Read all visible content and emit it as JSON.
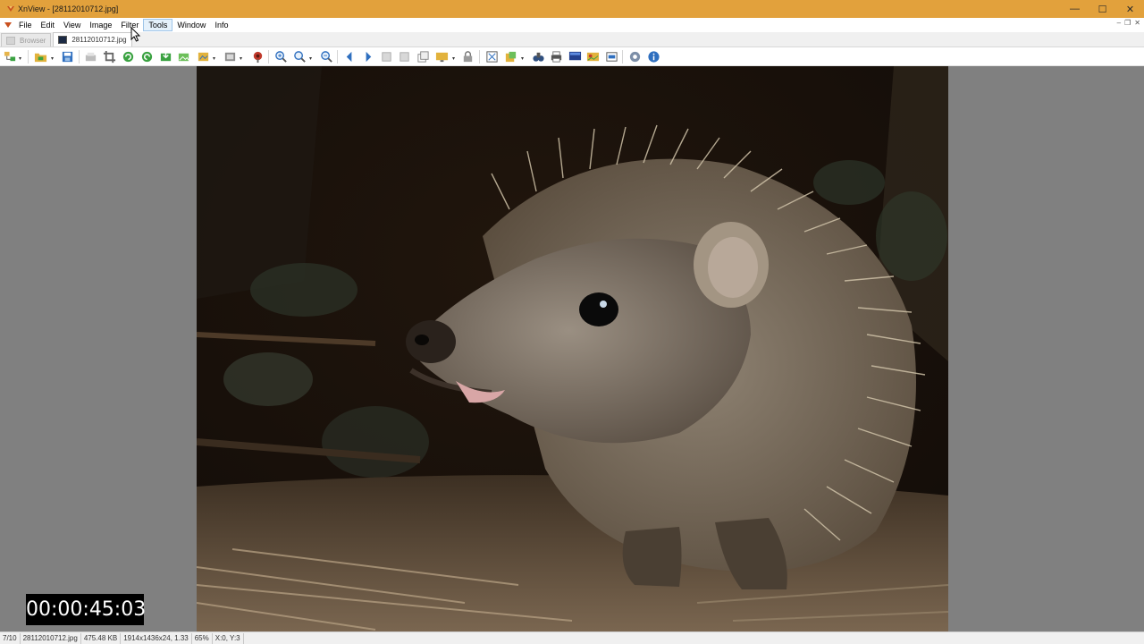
{
  "window": {
    "title": "XnView - [28112010712.jpg]",
    "controls": {
      "minimize": "—",
      "maximize": "☐",
      "close": "✕"
    },
    "mdi_controls": [
      "–",
      "❐",
      "✕"
    ]
  },
  "menu": {
    "items": [
      "File",
      "Edit",
      "View",
      "Image",
      "Filter",
      "Tools",
      "Window",
      "Info"
    ],
    "hovered": "Tools"
  },
  "tabs": [
    {
      "label": "Browser",
      "active": false
    },
    {
      "label": "28112010712.jpg",
      "active": true
    }
  ],
  "toolbar": {
    "icons": [
      "browser-tree-icon",
      "open-folder-icon",
      "save-icon",
      "print-preview-icon",
      "crop-icon",
      "rotate-left-icon",
      "rotate-right-icon",
      "export-icon",
      "acquire-icon",
      "slideshow-icon",
      "filmstrip-icon",
      "red-eye-icon",
      "zoom-in-icon",
      "zoom-icon",
      "zoom-out-icon",
      "previous-icon",
      "next-icon",
      "first-icon",
      "last-icon",
      "copy-icon",
      "wallpaper-icon",
      "lock-icon",
      "fit-icon",
      "paste-icon",
      "find-icon",
      "print-icon",
      "monitor-icon",
      "photo-edit-icon",
      "scanner-icon",
      "settings-icon",
      "info-icon"
    ],
    "accent_green": "#3aa241",
    "accent_blue": "#2f6fbf"
  },
  "image": {
    "description_colors": {
      "background": "#1a120c",
      "animal": "#8a7a68",
      "ground": "#6b5844"
    }
  },
  "status": {
    "index": "7/10",
    "filename": "28112010712.jpg",
    "filesize": "475.48 KB",
    "dimensions": "1914x1436x24, 1.33",
    "zoom": "65%",
    "coords": "X:0, Y:3"
  },
  "overlay": {
    "timer": "00:00:45:03"
  },
  "colors": {
    "titlebar": "#E2A13C",
    "viewer_bg": "#808080"
  }
}
